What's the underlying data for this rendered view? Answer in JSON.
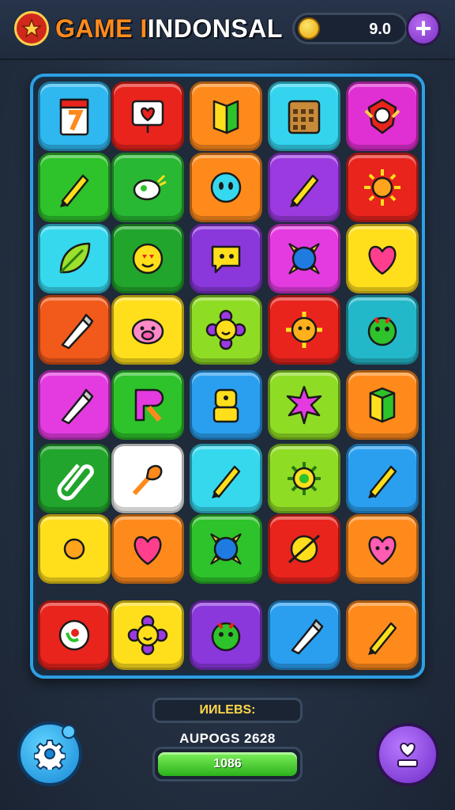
{
  "header": {
    "title_part1": "GAME I",
    "title_part2": "INDONSAL",
    "score": "9.0",
    "add_label": "+",
    "icons": {
      "logo": "emblem-icon",
      "coin": "coin-icon"
    }
  },
  "board": {
    "rows": [
      [
        {
          "icon": "notepad-icon",
          "color": "#2fb7f0"
        },
        {
          "icon": "heart-sign-icon",
          "color": "#e8241d"
        },
        {
          "icon": "book-icon",
          "color": "#ff8a1c"
        },
        {
          "icon": "calendar-icon",
          "color": "#34d4ee"
        },
        {
          "icon": "emblem-icon",
          "color": "#e02fd2"
        }
      ],
      [
        {
          "icon": "pencil-icon",
          "color": "#2ec22b"
        },
        {
          "icon": "bird-icon",
          "color": "#28b833"
        },
        {
          "icon": "ball-face-icon",
          "color": "#ff8a1c"
        },
        {
          "icon": "pencil-icon",
          "color": "#9b3ae0"
        },
        {
          "icon": "sun-icon",
          "color": "#e8241d"
        }
      ],
      [
        {
          "icon": "leaf-icon",
          "color": "#36d8ee"
        },
        {
          "icon": "love-face-icon",
          "color": "#22a52c"
        },
        {
          "icon": "chat-face-icon",
          "color": "#8a37dc"
        },
        {
          "icon": "orb-icon",
          "color": "#e33be0"
        },
        {
          "icon": "heart-icon",
          "color": "#ffdf1c"
        }
      ],
      [
        {
          "icon": "crayon-icon",
          "color": "#f15a1b"
        },
        {
          "icon": "pig-face-icon",
          "color": "#ffdf1c"
        },
        {
          "icon": "flower-face-icon",
          "color": "#8fdc25"
        },
        {
          "icon": "sun-face-icon",
          "color": "#e8241d"
        },
        {
          "icon": "monster-icon",
          "color": "#23b8c9"
        }
      ],
      [
        {
          "icon": "crayon-icon",
          "color": "#e33be0"
        },
        {
          "icon": "letter-r-icon",
          "color": "#2ec22b"
        },
        {
          "icon": "robot-icon",
          "color": "#2a9ff0"
        },
        {
          "icon": "star-burst-icon",
          "color": "#8fdc25"
        },
        {
          "icon": "box-icon",
          "color": "#ff8a1c"
        }
      ],
      [
        {
          "icon": "clip-icon",
          "color": "#22a52c"
        },
        {
          "icon": "brush-icon",
          "color": "#ffffff"
        },
        {
          "icon": "pencil-icon",
          "color": "#36d8ee"
        },
        {
          "icon": "gear-flower-icon",
          "color": "#8fdc25"
        },
        {
          "icon": "pencil-icon",
          "color": "#2a9ff0"
        }
      ],
      [
        {
          "icon": "sun-icon",
          "color": "#ffdf1c"
        },
        {
          "icon": "heart-icon",
          "color": "#ff8a1c"
        },
        {
          "icon": "orb-icon",
          "color": "#2ec22b"
        },
        {
          "icon": "planet-icon",
          "color": "#e8241d"
        },
        {
          "icon": "heart-face-icon",
          "color": "#ff8a1c"
        }
      ],
      [
        {
          "icon": "target-icon",
          "color": "#e8241d"
        },
        {
          "icon": "flower-face-icon",
          "color": "#ffdf1c"
        },
        {
          "icon": "monster-icon",
          "color": "#8a37dc"
        },
        {
          "icon": "crayon-icon",
          "color": "#2a9ff0"
        },
        {
          "icon": "pencil-icon",
          "color": "#ff8a1c"
        }
      ]
    ]
  },
  "footer": {
    "label": "ИИLEBS:",
    "subtitle": "AUPOGS 2628",
    "progress_text": "1086",
    "progress": 1.0,
    "icons": {
      "settings": "gear-icon",
      "profile": "heart-icon"
    }
  }
}
